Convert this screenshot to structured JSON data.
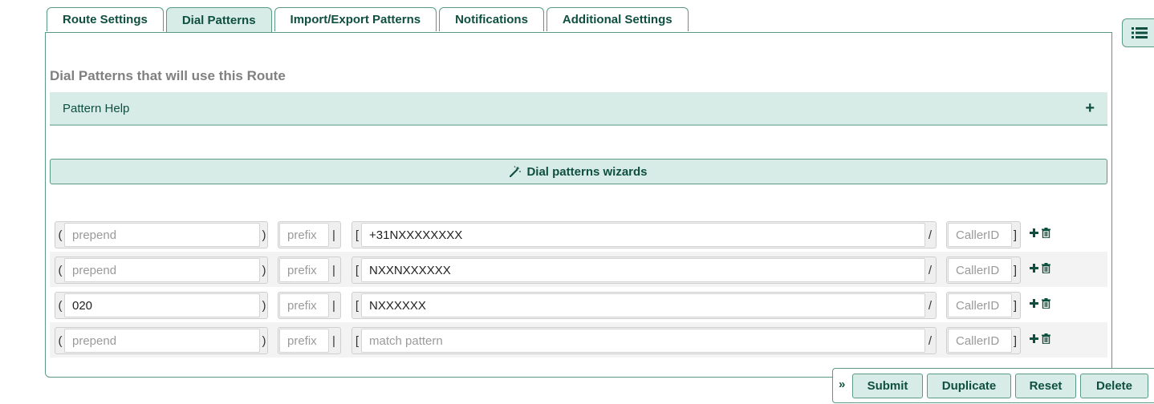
{
  "tabs": [
    {
      "label": "Route Settings",
      "active": false
    },
    {
      "label": "Dial Patterns",
      "active": true
    },
    {
      "label": "Import/Export Patterns",
      "active": false
    },
    {
      "label": "Notifications",
      "active": false
    },
    {
      "label": "Additional Settings",
      "active": false
    }
  ],
  "section_title": "Dial Patterns that will use this Route",
  "pattern_help": {
    "label": "Pattern Help",
    "toggle": "+"
  },
  "wizard_button": {
    "label": "Dial patterns wizards",
    "icon": "magic-wand-icon"
  },
  "pattern_rows": [
    {
      "prepend": "",
      "prefix": "",
      "match": "+31NXXXXXXXX",
      "callerid": ""
    },
    {
      "prepend": "",
      "prefix": "",
      "match": "NXXNXXXXXX",
      "callerid": ""
    },
    {
      "prepend": "020",
      "prefix": "",
      "match": "NXXXXXX",
      "callerid": ""
    },
    {
      "prepend": "",
      "prefix": "",
      "match": "",
      "callerid": ""
    }
  ],
  "placeholders": {
    "prepend": "prepend",
    "prefix": "prefix",
    "match": "match pattern",
    "callerid": "CallerID"
  },
  "brackets": {
    "prepend_open": "(",
    "prepend_close": ")",
    "prefix_sep": "|",
    "match_open": "[",
    "match_sep": "/",
    "callerid_close": "]"
  },
  "row_actions": [
    "plus-icon",
    "trash-icon"
  ],
  "footer": {
    "collapse": "»",
    "submit": "Submit",
    "duplicate": "Duplicate",
    "reset": "Reset",
    "delete": "Delete"
  },
  "side_button": {
    "icon": "list-icon"
  },
  "colors": {
    "accent": "#0f4f3f",
    "border": "#5a9a84",
    "light_fill": "#d7ece6"
  }
}
